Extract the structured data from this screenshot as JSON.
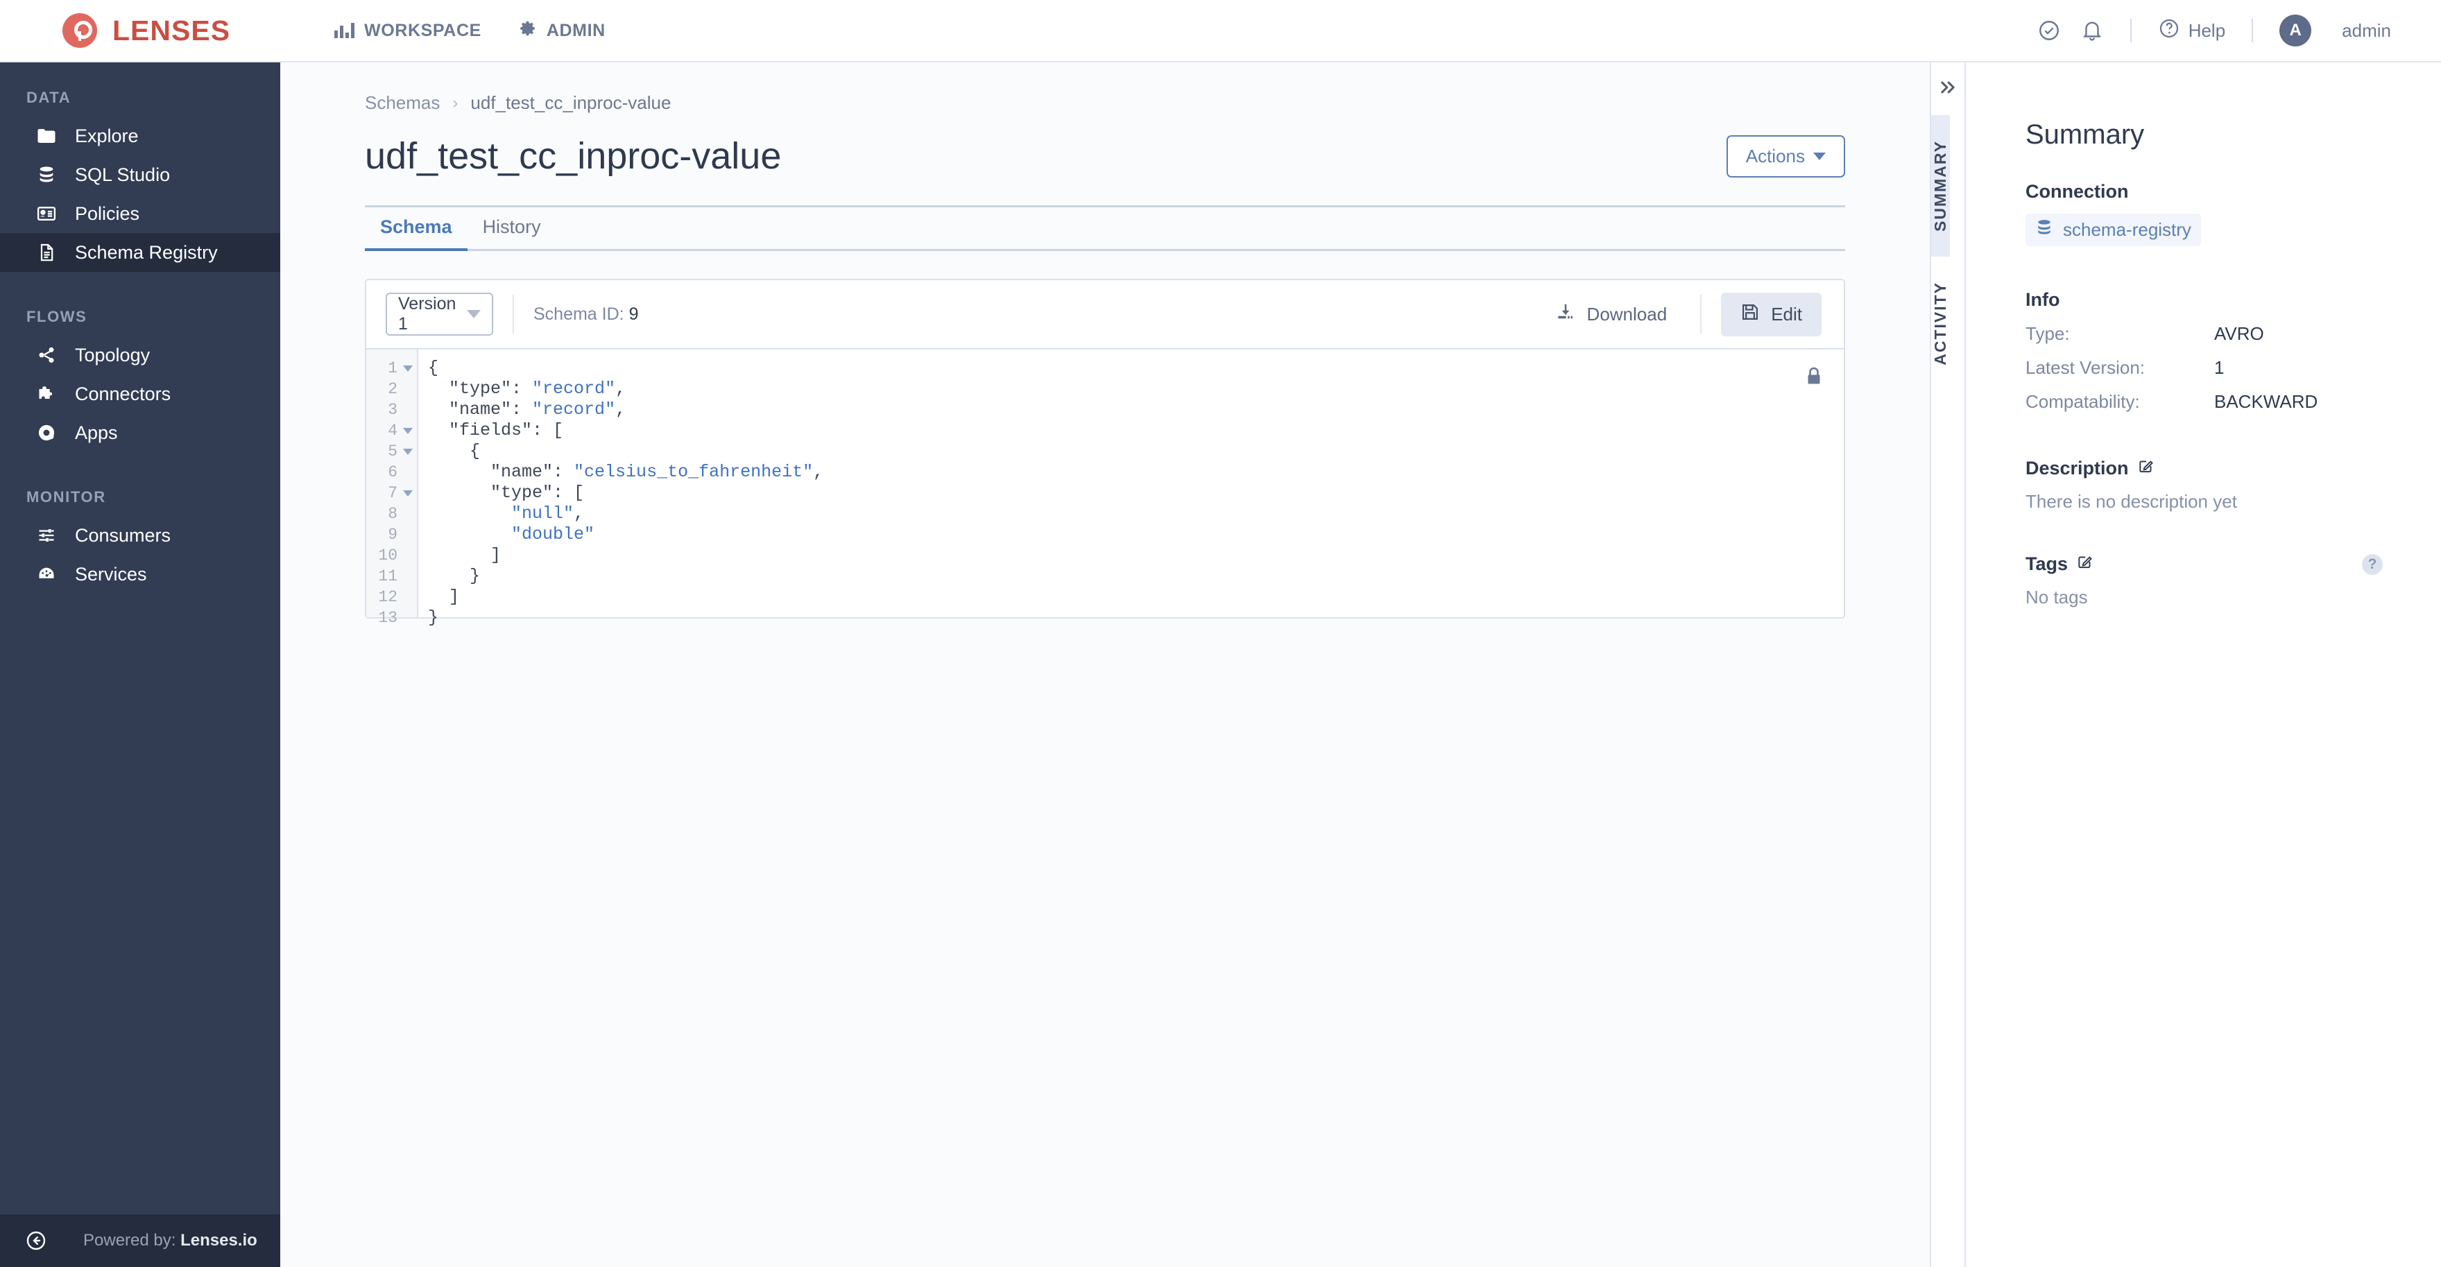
{
  "topbar": {
    "brand": "LENSES",
    "nav": [
      {
        "label": "WORKSPACE",
        "icon": "chart-bars-icon"
      },
      {
        "label": "ADMIN",
        "icon": "gear-icon"
      }
    ],
    "help_label": "Help",
    "user": "admin",
    "avatar_initial": "A",
    "icons": [
      "check-circle-icon",
      "bell-icon",
      "question-circle-icon"
    ]
  },
  "sidebar": {
    "groups": [
      {
        "label": "DATA",
        "items": [
          {
            "label": "Explore",
            "icon": "folder-icon",
            "active": false
          },
          {
            "label": "SQL Studio",
            "icon": "database-icon",
            "active": false
          },
          {
            "label": "Policies",
            "icon": "id-card-icon",
            "active": false
          },
          {
            "label": "Schema Registry",
            "icon": "document-icon",
            "active": true
          }
        ]
      },
      {
        "label": "FLOWS",
        "items": [
          {
            "label": "Topology",
            "icon": "share-nodes-icon",
            "active": false
          },
          {
            "label": "Connectors",
            "icon": "puzzle-icon",
            "active": false
          },
          {
            "label": "Apps",
            "icon": "apps-circle-icon",
            "active": false
          }
        ]
      },
      {
        "label": "MONITOR",
        "items": [
          {
            "label": "Consumers",
            "icon": "sliders-icon",
            "active": false
          },
          {
            "label": "Services",
            "icon": "gauge-icon",
            "active": false
          }
        ]
      }
    ],
    "footer": {
      "prefix": "Powered by: ",
      "brand": "Lenses.io",
      "icon": "back-arrow-circle-icon"
    }
  },
  "main": {
    "breadcrumb": {
      "root": "Schemas",
      "separator": "›",
      "current": "udf_test_cc_inproc-value"
    },
    "page_title": "udf_test_cc_inproc-value",
    "actions_button": "Actions",
    "tabs": [
      {
        "label": "Schema",
        "active": true
      },
      {
        "label": "History",
        "active": false
      }
    ],
    "toolbar": {
      "version_value": "Version 1",
      "version_options": [
        "Version 1"
      ],
      "schema_id_label": "Schema ID:",
      "schema_id_value": "9",
      "download_label": "Download",
      "edit_label": "Edit"
    },
    "editor": {
      "locked": true,
      "lines": [
        {
          "n": "1",
          "fold": true,
          "text": "{"
        },
        {
          "n": "2",
          "fold": false,
          "text": "  \"type\": \"record\","
        },
        {
          "n": "3",
          "fold": false,
          "text": "  \"name\": \"record\","
        },
        {
          "n": "4",
          "fold": true,
          "text": "  \"fields\": ["
        },
        {
          "n": "5",
          "fold": true,
          "text": "    {"
        },
        {
          "n": "6",
          "fold": false,
          "text": "      \"name\": \"celsius_to_fahrenheit\","
        },
        {
          "n": "7",
          "fold": true,
          "text": "      \"type\": ["
        },
        {
          "n": "8",
          "fold": false,
          "text": "        \"null\","
        },
        {
          "n": "9",
          "fold": false,
          "text": "        \"double\""
        },
        {
          "n": "10",
          "fold": false,
          "text": "      ]"
        },
        {
          "n": "11",
          "fold": false,
          "text": "    }"
        },
        {
          "n": "12",
          "fold": false,
          "text": "  ]"
        },
        {
          "n": "13",
          "fold": false,
          "text": "}"
        }
      ]
    }
  },
  "rail": {
    "collapse_icon": "chevron-double-right-icon",
    "tabs": [
      {
        "label": "SUMMARY",
        "active": true
      },
      {
        "label": "ACTIVITY",
        "active": false
      }
    ]
  },
  "right_panel": {
    "title": "Summary",
    "connection": {
      "heading": "Connection",
      "value": "schema-registry",
      "icon": "database-icon"
    },
    "info": {
      "heading": "Info",
      "rows": [
        {
          "label": "Type:",
          "value": "AVRO"
        },
        {
          "label": "Latest Version:",
          "value": "1"
        },
        {
          "label": "Compatability:",
          "value": "BACKWARD"
        }
      ]
    },
    "description": {
      "heading": "Description",
      "empty_text": "There is no description yet",
      "edit_icon": "edit-pencil-icon"
    },
    "tags": {
      "heading": "Tags",
      "empty_text": "No tags",
      "edit_icon": "edit-pencil-icon",
      "help_icon": "question-mark-icon",
      "help_glyph": "?"
    }
  },
  "colors": {
    "brand_red": "#c94f42",
    "accent_blue": "#4a79b8",
    "sidebar_bg": "#323c53",
    "sidebar_active": "#242c3e",
    "code_string": "#3f72bf"
  }
}
